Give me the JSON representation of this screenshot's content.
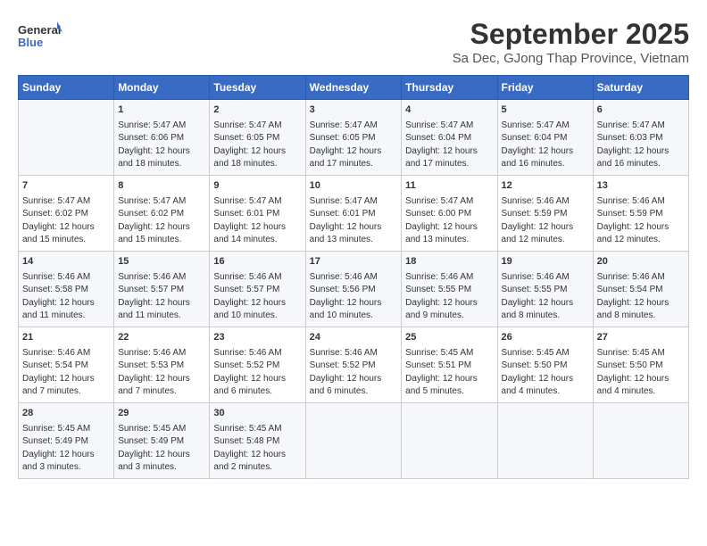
{
  "header": {
    "logo_line1": "General",
    "logo_line2": "Blue",
    "month": "September 2025",
    "location": "Sa Dec, GJong Thap Province, Vietnam"
  },
  "weekdays": [
    "Sunday",
    "Monday",
    "Tuesday",
    "Wednesday",
    "Thursday",
    "Friday",
    "Saturday"
  ],
  "weeks": [
    [
      {
        "day": "",
        "info": ""
      },
      {
        "day": "1",
        "info": "Sunrise: 5:47 AM\nSunset: 6:06 PM\nDaylight: 12 hours\nand 18 minutes."
      },
      {
        "day": "2",
        "info": "Sunrise: 5:47 AM\nSunset: 6:05 PM\nDaylight: 12 hours\nand 18 minutes."
      },
      {
        "day": "3",
        "info": "Sunrise: 5:47 AM\nSunset: 6:05 PM\nDaylight: 12 hours\nand 17 minutes."
      },
      {
        "day": "4",
        "info": "Sunrise: 5:47 AM\nSunset: 6:04 PM\nDaylight: 12 hours\nand 17 minutes."
      },
      {
        "day": "5",
        "info": "Sunrise: 5:47 AM\nSunset: 6:04 PM\nDaylight: 12 hours\nand 16 minutes."
      },
      {
        "day": "6",
        "info": "Sunrise: 5:47 AM\nSunset: 6:03 PM\nDaylight: 12 hours\nand 16 minutes."
      }
    ],
    [
      {
        "day": "7",
        "info": "Sunrise: 5:47 AM\nSunset: 6:02 PM\nDaylight: 12 hours\nand 15 minutes."
      },
      {
        "day": "8",
        "info": "Sunrise: 5:47 AM\nSunset: 6:02 PM\nDaylight: 12 hours\nand 15 minutes."
      },
      {
        "day": "9",
        "info": "Sunrise: 5:47 AM\nSunset: 6:01 PM\nDaylight: 12 hours\nand 14 minutes."
      },
      {
        "day": "10",
        "info": "Sunrise: 5:47 AM\nSunset: 6:01 PM\nDaylight: 12 hours\nand 13 minutes."
      },
      {
        "day": "11",
        "info": "Sunrise: 5:47 AM\nSunset: 6:00 PM\nDaylight: 12 hours\nand 13 minutes."
      },
      {
        "day": "12",
        "info": "Sunrise: 5:46 AM\nSunset: 5:59 PM\nDaylight: 12 hours\nand 12 minutes."
      },
      {
        "day": "13",
        "info": "Sunrise: 5:46 AM\nSunset: 5:59 PM\nDaylight: 12 hours\nand 12 minutes."
      }
    ],
    [
      {
        "day": "14",
        "info": "Sunrise: 5:46 AM\nSunset: 5:58 PM\nDaylight: 12 hours\nand 11 minutes."
      },
      {
        "day": "15",
        "info": "Sunrise: 5:46 AM\nSunset: 5:57 PM\nDaylight: 12 hours\nand 11 minutes."
      },
      {
        "day": "16",
        "info": "Sunrise: 5:46 AM\nSunset: 5:57 PM\nDaylight: 12 hours\nand 10 minutes."
      },
      {
        "day": "17",
        "info": "Sunrise: 5:46 AM\nSunset: 5:56 PM\nDaylight: 12 hours\nand 10 minutes."
      },
      {
        "day": "18",
        "info": "Sunrise: 5:46 AM\nSunset: 5:55 PM\nDaylight: 12 hours\nand 9 minutes."
      },
      {
        "day": "19",
        "info": "Sunrise: 5:46 AM\nSunset: 5:55 PM\nDaylight: 12 hours\nand 8 minutes."
      },
      {
        "day": "20",
        "info": "Sunrise: 5:46 AM\nSunset: 5:54 PM\nDaylight: 12 hours\nand 8 minutes."
      }
    ],
    [
      {
        "day": "21",
        "info": "Sunrise: 5:46 AM\nSunset: 5:54 PM\nDaylight: 12 hours\nand 7 minutes."
      },
      {
        "day": "22",
        "info": "Sunrise: 5:46 AM\nSunset: 5:53 PM\nDaylight: 12 hours\nand 7 minutes."
      },
      {
        "day": "23",
        "info": "Sunrise: 5:46 AM\nSunset: 5:52 PM\nDaylight: 12 hours\nand 6 minutes."
      },
      {
        "day": "24",
        "info": "Sunrise: 5:46 AM\nSunset: 5:52 PM\nDaylight: 12 hours\nand 6 minutes."
      },
      {
        "day": "25",
        "info": "Sunrise: 5:45 AM\nSunset: 5:51 PM\nDaylight: 12 hours\nand 5 minutes."
      },
      {
        "day": "26",
        "info": "Sunrise: 5:45 AM\nSunset: 5:50 PM\nDaylight: 12 hours\nand 4 minutes."
      },
      {
        "day": "27",
        "info": "Sunrise: 5:45 AM\nSunset: 5:50 PM\nDaylight: 12 hours\nand 4 minutes."
      }
    ],
    [
      {
        "day": "28",
        "info": "Sunrise: 5:45 AM\nSunset: 5:49 PM\nDaylight: 12 hours\nand 3 minutes."
      },
      {
        "day": "29",
        "info": "Sunrise: 5:45 AM\nSunset: 5:49 PM\nDaylight: 12 hours\nand 3 minutes."
      },
      {
        "day": "30",
        "info": "Sunrise: 5:45 AM\nSunset: 5:48 PM\nDaylight: 12 hours\nand 2 minutes."
      },
      {
        "day": "",
        "info": ""
      },
      {
        "day": "",
        "info": ""
      },
      {
        "day": "",
        "info": ""
      },
      {
        "day": "",
        "info": ""
      }
    ]
  ]
}
